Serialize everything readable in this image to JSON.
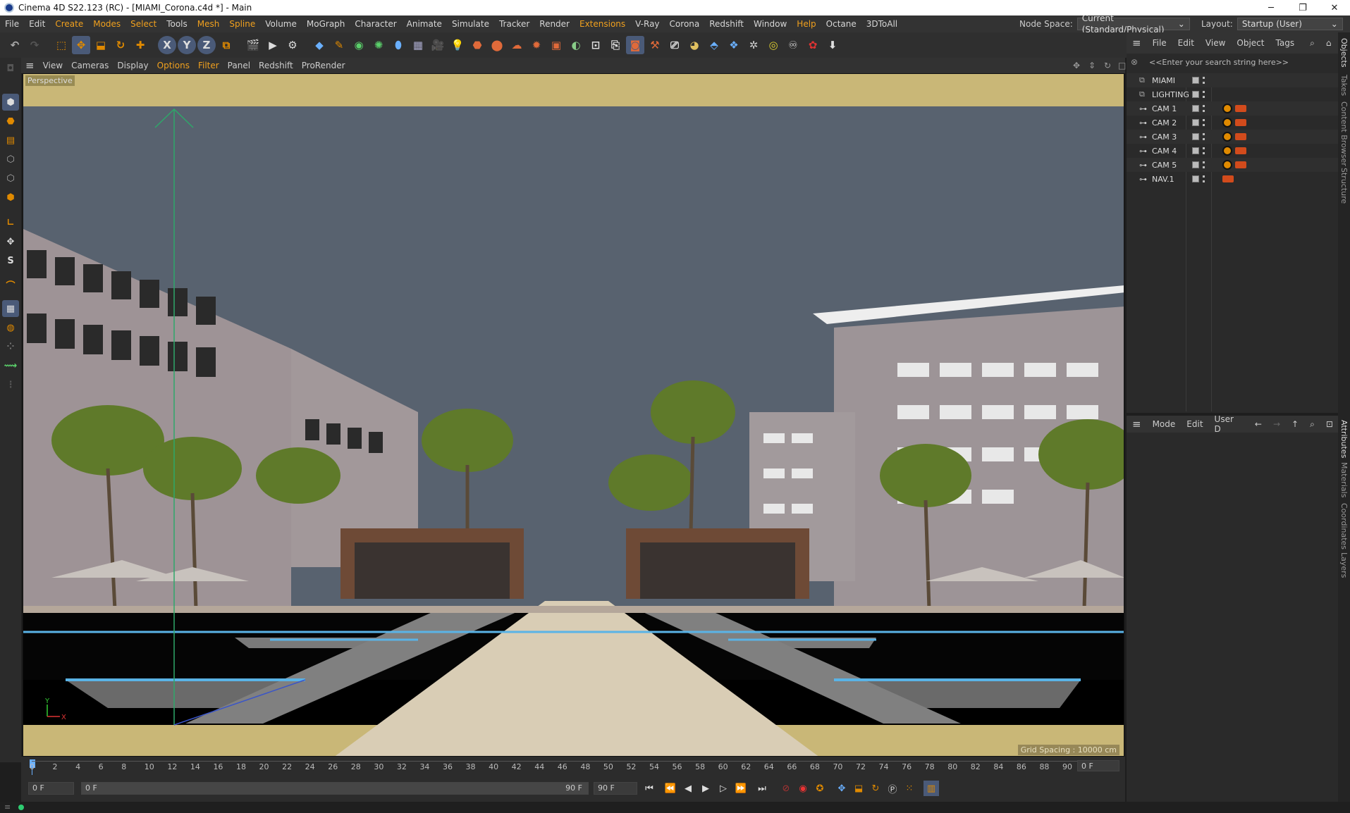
{
  "title": "Cinema 4D S22.123 (RC) - [MIAMI_Corona.c4d *] - Main",
  "window_controls": {
    "minimize": "─",
    "restore": "❐",
    "close": "✕"
  },
  "menu": [
    "File",
    "Edit",
    "Create",
    "Modes",
    "Select",
    "Tools",
    "Mesh",
    "Spline",
    "Volume",
    "MoGraph",
    "Character",
    "Animate",
    "Simulate",
    "Tracker",
    "Render",
    "Extensions",
    "V-Ray",
    "Corona",
    "Redshift",
    "Window",
    "Help",
    "Octane",
    "3DToAll"
  ],
  "node_space": {
    "label": "Node Space:",
    "value": "Current (Standard/Physical)"
  },
  "layout": {
    "label": "Layout:",
    "value": "Startup (User)"
  },
  "viewport_menu": [
    "View",
    "Cameras",
    "Display",
    "Options",
    "Filter",
    "Panel",
    "Redshift",
    "ProRender"
  ],
  "viewport_label": "Perspective",
  "grid_spacing": "Grid Spacing : 10000 cm",
  "axis": {
    "y": "Y",
    "x": "X"
  },
  "object_manager": {
    "menu": [
      "File",
      "Edit",
      "View",
      "Object",
      "Tags"
    ],
    "search_placeholder": "<<Enter your search string here>>",
    "objects": [
      {
        "name": "MIAMI",
        "type": "layer"
      },
      {
        "name": "LIGHTING",
        "type": "layer"
      },
      {
        "name": "CAM 1",
        "type": "camera"
      },
      {
        "name": "CAM 2",
        "type": "camera"
      },
      {
        "name": "CAM 3",
        "type": "camera"
      },
      {
        "name": "CAM 4",
        "type": "camera"
      },
      {
        "name": "CAM 5",
        "type": "camera"
      },
      {
        "name": "NAV.1",
        "type": "camera"
      }
    ]
  },
  "attribute_manager": {
    "menu": [
      "Mode",
      "Edit",
      "User D"
    ]
  },
  "right_tabs": [
    "Objects",
    "Takes",
    "Content Browser",
    "Structure",
    "Attributes",
    "Materials",
    "Coordinates",
    "Layers"
  ],
  "timeline": {
    "ticks": [
      "0",
      "2",
      "4",
      "6",
      "8",
      "10",
      "12",
      "14",
      "16",
      "18",
      "20",
      "22",
      "24",
      "26",
      "28",
      "30",
      "32",
      "34",
      "36",
      "38",
      "40",
      "42",
      "44",
      "46",
      "48",
      "50",
      "52",
      "54",
      "56",
      "58",
      "60",
      "62",
      "64",
      "66",
      "68",
      "70",
      "72",
      "74",
      "76",
      "78",
      "80",
      "82",
      "84",
      "86",
      "88",
      "90"
    ],
    "current_frame": "0 F"
  },
  "transport": {
    "start": "0 F",
    "current": "0 F",
    "end_field": "90 F",
    "max": "90 F"
  },
  "toolbar_icons": [
    "undo-icon",
    "redo-icon",
    "live-selection-icon",
    "move-icon",
    "scale-icon",
    "rotate-icon",
    "add-icon",
    "x-axis-icon",
    "y-axis-icon",
    "z-axis-icon",
    "coordinate-icon",
    "render-view-icon",
    "render-icon",
    "render-settings-icon",
    "cube-icon",
    "pen-icon",
    "subdivision-icon",
    "cloner-icon",
    "deformer-icon",
    "floor-icon",
    "camera-icon",
    "light-icon",
    "material-icon"
  ]
}
